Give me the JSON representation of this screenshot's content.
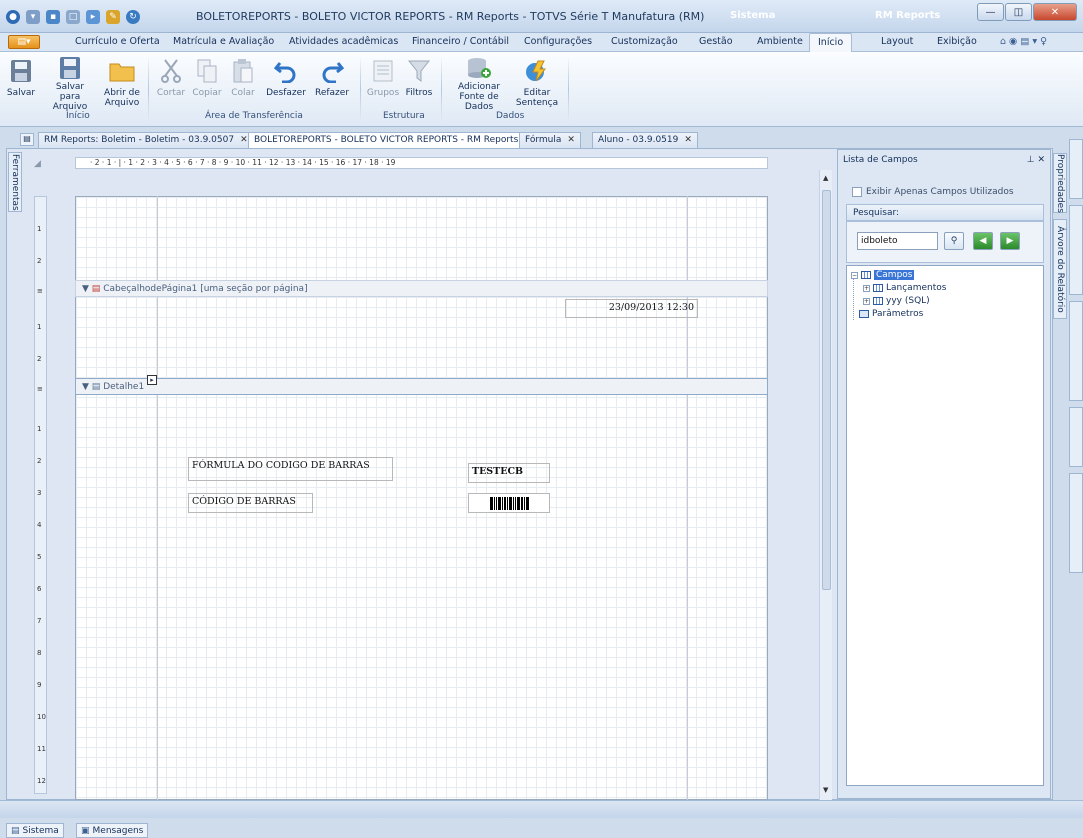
{
  "window": {
    "title": "BOLETOREPORTS - BOLETO VICTOR REPORTS - RM Reports - TOTVS Série T Manufatura (RM)",
    "sistema": "Sistema",
    "rmreports": "RM Reports"
  },
  "menu": {
    "items": [
      "Currículo e Oferta",
      "Matrícula e Avaliação",
      "Atividades acadêmicas",
      "Financeiro / Contábil",
      "Configurações",
      "Customização",
      "Gestão",
      "Ambiente",
      "Início",
      "Layout",
      "Exibição"
    ],
    "active": "Início"
  },
  "ribbon": {
    "salvar": "Salvar",
    "salvar_para": "Salvar para",
    "arquivo1": "Arquivo",
    "abrir_de": "Abrir de",
    "arquivo2": "Arquivo",
    "cortar": "Cortar",
    "copiar": "Copiar",
    "colar": "Colar",
    "desfazer": "Desfazer",
    "refazer": "Refazer",
    "grupos": "Grupos",
    "filtros": "Filtros",
    "adicionar": "Adicionar",
    "fonte_dados": "Fonte de Dados",
    "editar": "Editar",
    "sentenca": "Sentença",
    "group_inicio": "Início",
    "group_area": "Área de Transferência",
    "group_estrutura": "Estrutura",
    "group_dados": "Dados"
  },
  "doc_tabs": [
    {
      "label": "RM Reports: Boletim - Boletim - 03.9.0507",
      "selected": false
    },
    {
      "label": "BOLETOREPORTS - BOLETO VICTOR REPORTS - RM Reports",
      "selected": true
    },
    {
      "label": "Fórmula",
      "selected": false
    },
    {
      "label": "Aluno - 03.9.0519",
      "selected": false
    }
  ],
  "left_tab": "Ferramentas",
  "ruler": {
    "top": "· 2 · 1 · | · 1 · 2 · 3 · 4 · 5 · 6 · 7 · 8 · 9 · 10 · 11 · 12 · 13 · 14 · 15 · 16 · 17 · 18 · 19"
  },
  "designer": {
    "band_header": "CabeçalhodePágina1 [uma seção por página]",
    "band_detail": "Detalhe1",
    "date_field": "23/09/2013 12:30",
    "field_formula": "FÓRMULA DO CODIGO DE BARRAS",
    "field_testecb": "TESTECB",
    "field_codigo": "CÓDIGO DE BARRAS"
  },
  "field_panel": {
    "title": "Lista de Campos",
    "pin": "⊥ ✕",
    "checkbox": "Exibir Apenas Campos Utilizados",
    "search_label": "Pesquisar:",
    "search_value": "idboleto",
    "tree": {
      "campos": "Campos",
      "lancamentos": "Lançamentos",
      "yyy": "yyy (SQL)",
      "parametros": "Parâmetros"
    }
  },
  "right_tabs": {
    "propriedades": "Propriedades",
    "arvore": "Árvore do Relatório"
  },
  "bottom": {
    "sistema": "Sistema",
    "mensagens": "Mensagens"
  }
}
